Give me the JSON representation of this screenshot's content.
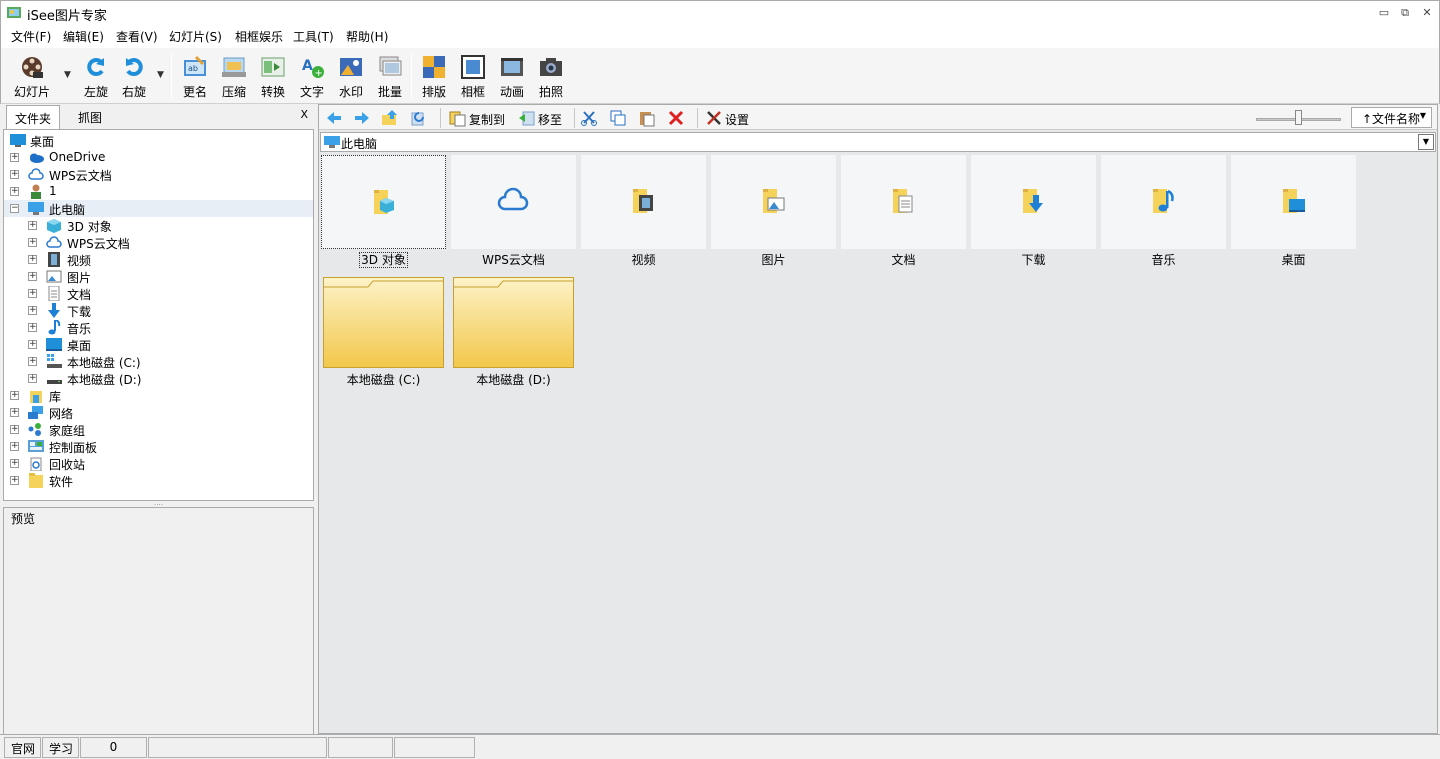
{
  "app": {
    "title": "iSee图片专家"
  },
  "window_controls": {
    "minimize": "▭",
    "restore": "⧉",
    "close": "✕"
  },
  "menu": [
    "文件(F)",
    "编辑(E)",
    "查看(V)",
    "幻灯片(S)",
    "相框娱乐",
    "工具(T)",
    "帮助(H)"
  ],
  "toolbar": {
    "slideshow": "幻灯片",
    "rotate_left": "左旋",
    "rotate_right": "右旋",
    "rename": "更名",
    "compress": "压缩",
    "convert": "转换",
    "text": "文字",
    "watermark": "水印",
    "batch": "批量",
    "layout": "排版",
    "frame": "相框",
    "animation": "动画",
    "photo": "拍照"
  },
  "left_tabs": {
    "folders": "文件夹",
    "capture": "抓图",
    "close": "X"
  },
  "tree": {
    "desktop": "桌面",
    "onedrive": "OneDrive",
    "wps_cloud": "WPS云文档",
    "user": "1",
    "this_pc": "此电脑",
    "objects_3d": "3D 对象",
    "wps_cloud_2": "WPS云文档",
    "videos": "视频",
    "pictures": "图片",
    "documents": "文档",
    "downloads": "下载",
    "music": "音乐",
    "desktop_2": "桌面",
    "drive_c": "本地磁盘 (C:)",
    "drive_d": "本地磁盘 (D:)",
    "library": "库",
    "network": "网络",
    "homegroup": "家庭组",
    "control_panel": "控制面板",
    "recycle_bin": "回收站",
    "software": "软件"
  },
  "preview": {
    "label": "预览"
  },
  "nav": {
    "copy_to": "复制到",
    "move_to": "移至",
    "settings": "设置",
    "sort": "↑文件名称"
  },
  "path": {
    "current": "此电脑"
  },
  "thumbs": {
    "t0": "3D 对象",
    "t1": "WPS云文档",
    "t2": "视频",
    "t3": "图片",
    "t4": "文档",
    "t5": "下载",
    "t6": "音乐",
    "t7": "桌面"
  },
  "drives": {
    "c": "本地磁盘 (C:)",
    "d": "本地磁盘 (D:)"
  },
  "status": {
    "website": "官网",
    "learn": "学习",
    "count": "0"
  },
  "colors": {
    "folder_yellow": "#f5d35b",
    "accent_blue": "#1e7fd6",
    "selection": "#e8eef6"
  }
}
